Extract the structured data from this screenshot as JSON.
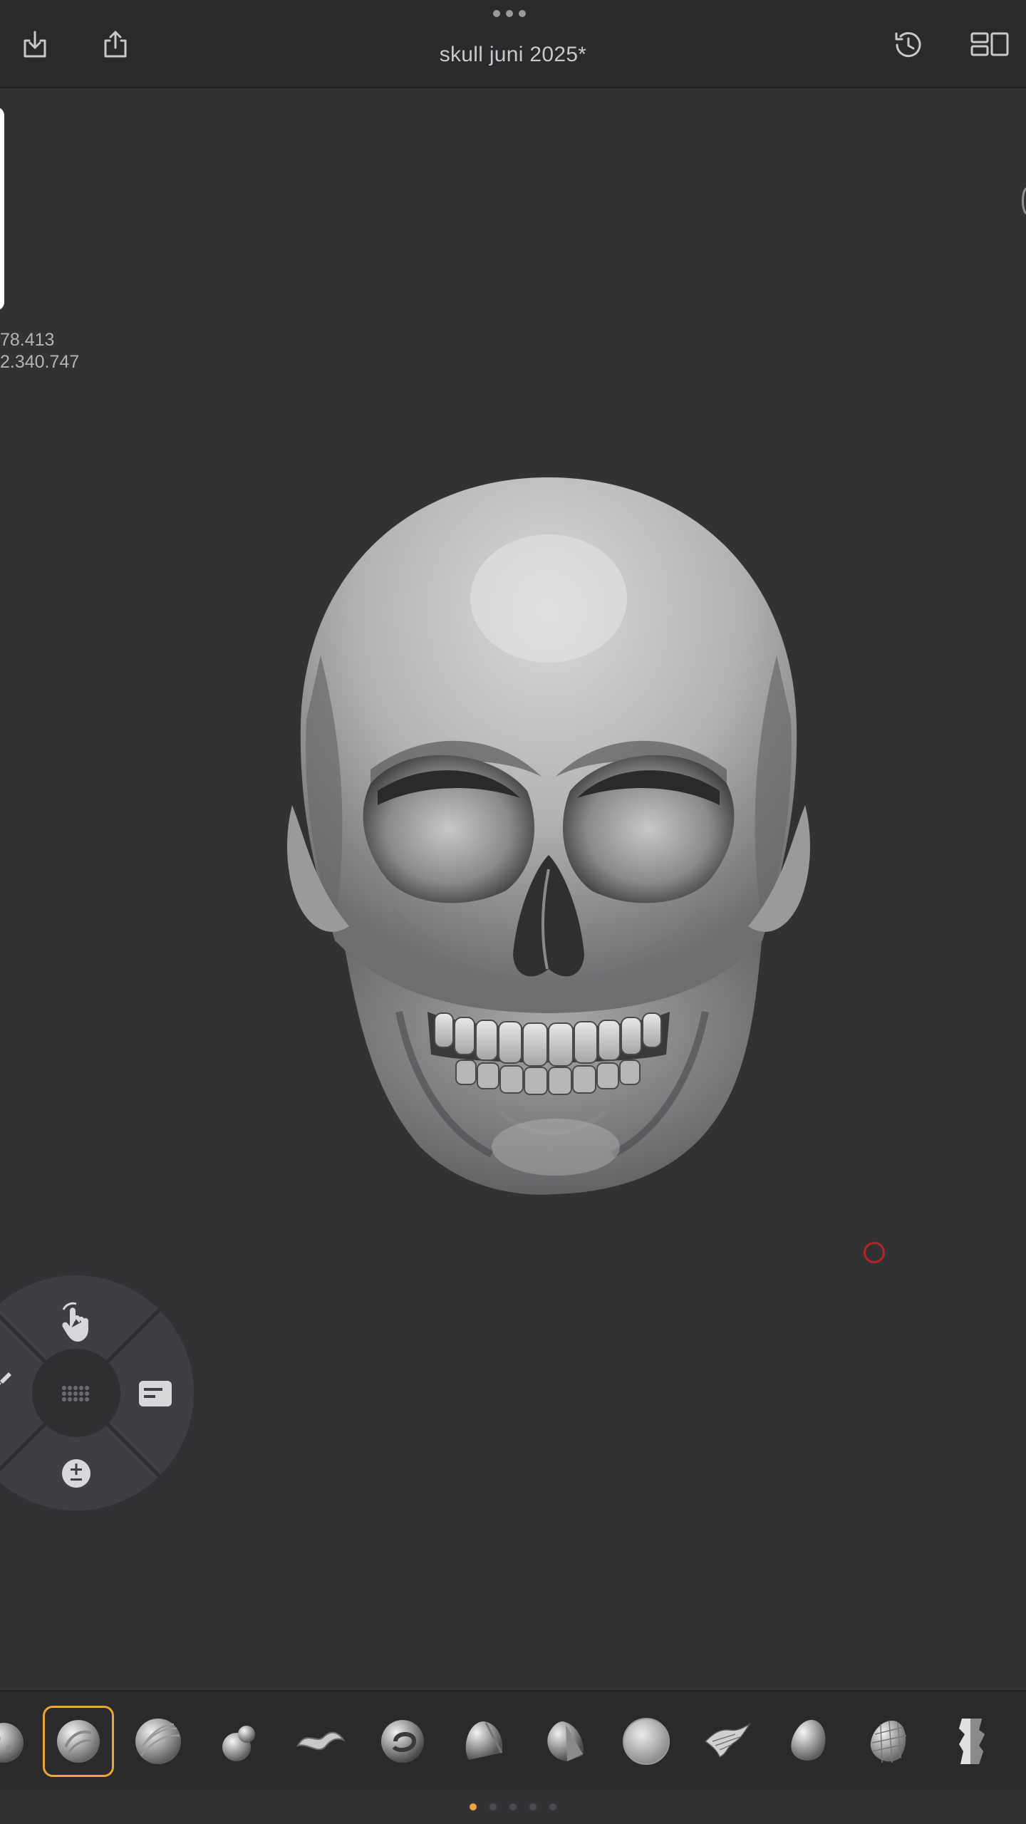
{
  "header": {
    "title": "skull juni 2025*",
    "icons": [
      "import-icon",
      "share-icon",
      "history-icon",
      "layout-icon",
      "more-icon"
    ]
  },
  "stats": {
    "line1": "78.413",
    "line2": "2.340.747"
  },
  "viewport": {
    "model": "skull-model"
  },
  "radial_menu": {
    "items": [
      "gesture-hand-icon",
      "brush-icon",
      "grid-icon",
      "settings-panel-icon",
      "plus-minus-icon"
    ]
  },
  "brush_bar": {
    "selected_index": 1,
    "items": [
      "brush-sphere-partial",
      "brush-clay",
      "brush-standard-lines",
      "brush-inflate",
      "brush-snake-hook",
      "brush-move",
      "brush-flatten",
      "brush-trim",
      "brush-smooth",
      "brush-dam-standard",
      "brush-pinch",
      "brush-mesh",
      "brush-planar"
    ]
  },
  "page_indicator": {
    "count": 5,
    "active": 0
  },
  "colors": {
    "background": "#323134",
    "bars": "#2a292c",
    "accent": "#e9a53b",
    "cursor": "#b52525"
  }
}
